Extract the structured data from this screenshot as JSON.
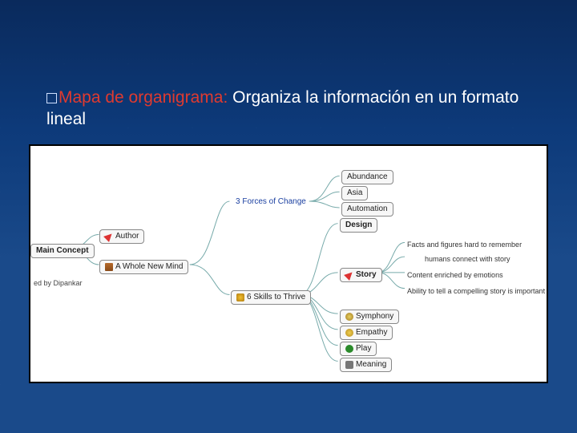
{
  "title": {
    "bullet": " ",
    "lead": "Mapa de organigrama:",
    "rest": " Organiza la información en un formato lineal"
  },
  "mindmap": {
    "left_root_partial": "ed by Dipankar",
    "main_concept": "Main Concept",
    "author": "Author",
    "book": "A Whole New Mind",
    "forces": "3 Forces of Change",
    "skills": "6 Skills to Thrive",
    "force_abundance": "Abundance",
    "force_asia": "Asia",
    "force_automation": "Automation",
    "skill_design": "Design",
    "skill_story": "Story",
    "skill_symphony": "Symphony",
    "skill_empathy": "Empathy",
    "skill_play": "Play",
    "skill_meaning": "Meaning",
    "story_leaf1": "Facts and figures hard to remember",
    "story_leaf2": "humans connect with story",
    "story_leaf3": "Content enriched by emotions",
    "story_leaf4": "Ability to tell a compelling story is important"
  }
}
